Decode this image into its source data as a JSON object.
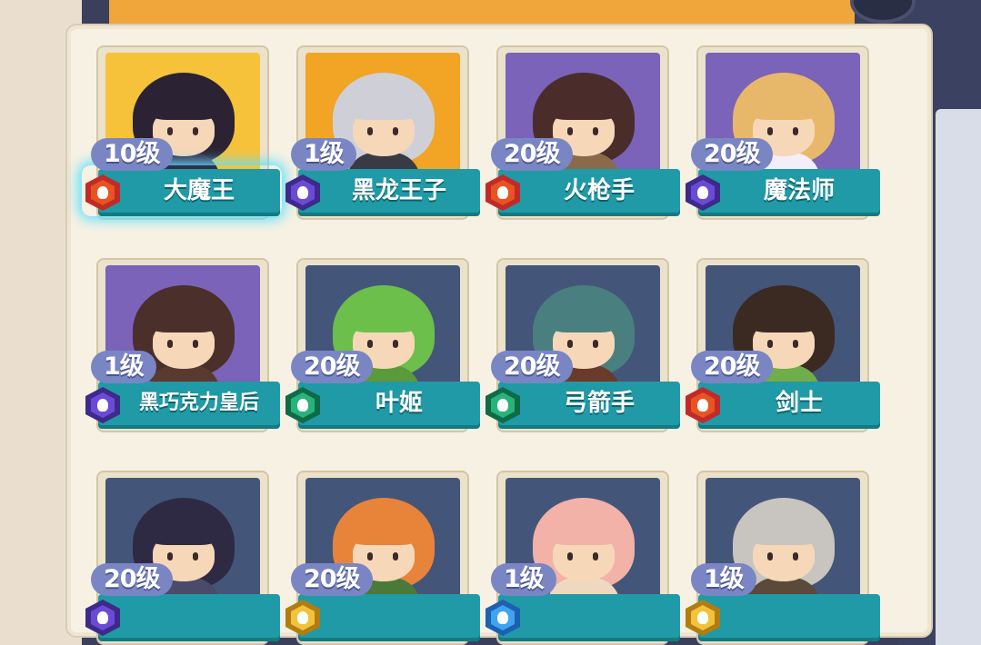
{
  "cards": [
    {
      "level": "10级",
      "name": "大魔王",
      "badge": "red",
      "bg": "#f6c23a",
      "hair": "#2b2234",
      "body": "#3a2a4a",
      "selected": true
    },
    {
      "level": "1级",
      "name": "黑龙王子",
      "badge": "purple",
      "bg": "#f2a424",
      "hair": "#cfcfd8",
      "body": "#3a3a44",
      "selected": false
    },
    {
      "level": "20级",
      "name": "火枪手",
      "badge": "red",
      "bg": "#7a63b8",
      "hair": "#4a2d2a",
      "body": "#8a6a4a",
      "selected": false
    },
    {
      "level": "20级",
      "name": "魔法师",
      "badge": "purple",
      "bg": "#7a63b8",
      "hair": "#e8b86a",
      "body": "#f2eefa",
      "selected": false
    },
    {
      "level": "1级",
      "name": "黑巧克力皇后",
      "badge": "purple",
      "bg": "#7a63b8",
      "hair": "#4a2f2a",
      "body": "#5a3a30",
      "selected": false
    },
    {
      "level": "20级",
      "name": "叶姬",
      "badge": "green",
      "bg": "#44557a",
      "hair": "#6cbf4a",
      "body": "#5a9a3a",
      "selected": false
    },
    {
      "level": "20级",
      "name": "弓箭手",
      "badge": "green",
      "bg": "#44557a",
      "hair": "#4a7f7f",
      "body": "#6a3a2a",
      "selected": false
    },
    {
      "level": "20级",
      "name": "剑士",
      "badge": "red",
      "bg": "#44557a",
      "hair": "#3a2a22",
      "body": "#6fae4a",
      "selected": false
    },
    {
      "level": "20级",
      "name": "",
      "badge": "purple",
      "bg": "#44557a",
      "hair": "#2f2a44",
      "body": "#4a4a6a",
      "selected": false
    },
    {
      "level": "20级",
      "name": "",
      "badge": "gold",
      "bg": "#44557a",
      "hair": "#e8843a",
      "body": "#4a7a3a",
      "selected": false
    },
    {
      "level": "1级",
      "name": "",
      "badge": "blue",
      "bg": "#44557a",
      "hair": "#f2b2a8",
      "body": "#f0d8c0",
      "selected": false
    },
    {
      "level": "1级",
      "name": "",
      "badge": "gold",
      "bg": "#44557a",
      "hair": "#c8c4c0",
      "body": "#5a4a3a",
      "selected": false
    }
  ]
}
